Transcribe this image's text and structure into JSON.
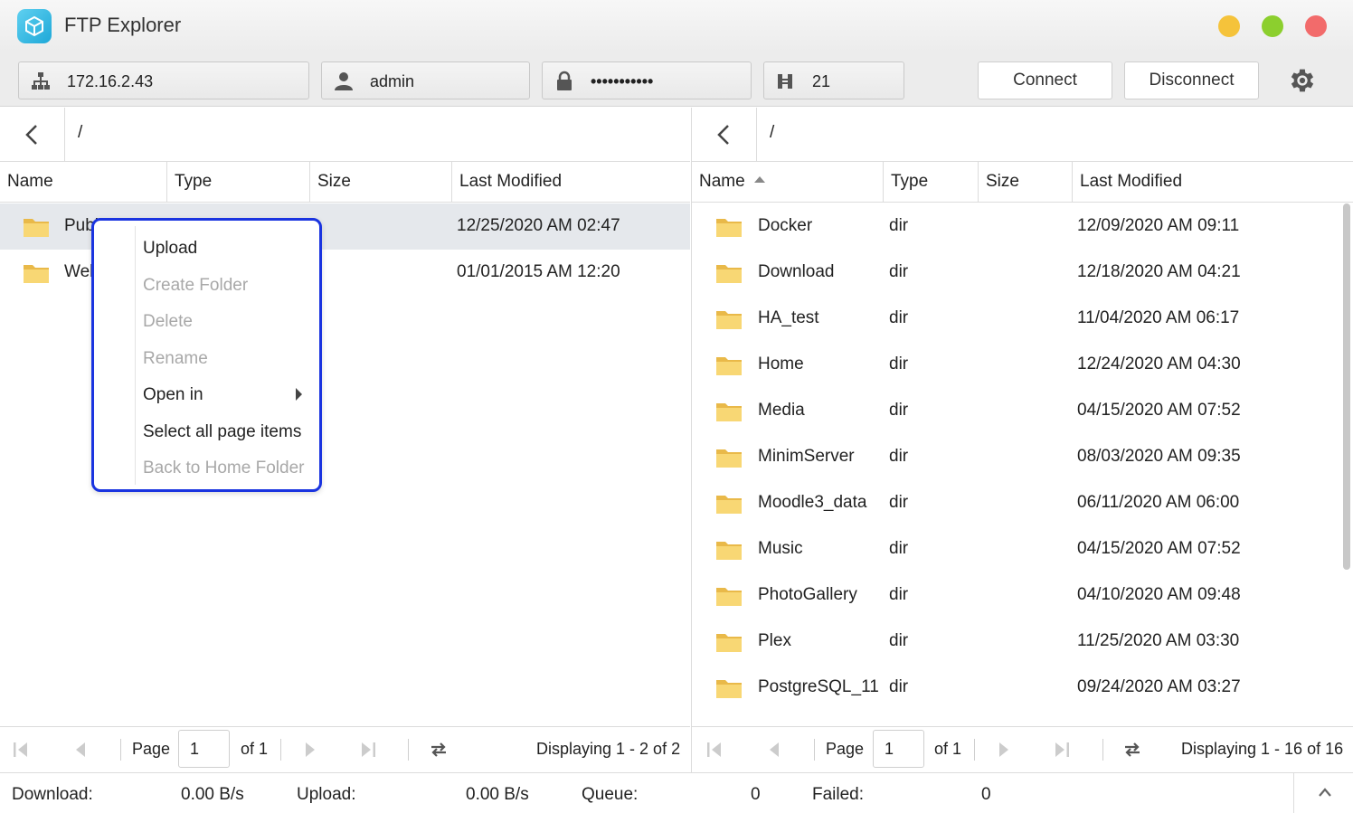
{
  "window": {
    "title": "FTP Explorer",
    "app_icon": "cube-icon",
    "controls": [
      {
        "name": "minimize",
        "color": "#f5c33b"
      },
      {
        "name": "maximize",
        "color": "#8ccf2e"
      },
      {
        "name": "close",
        "color": "#f26b6b"
      }
    ]
  },
  "toolbar": {
    "host": "172.16.2.43",
    "user": "admin",
    "password": "•••••••••••",
    "port": "21",
    "connect_label": "Connect",
    "disconnect_label": "Disconnect",
    "settings_icon": "gear-icon"
  },
  "left": {
    "path": "/",
    "columns": [
      "Name",
      "Type",
      "Size",
      "Last Modified"
    ],
    "rows": [
      {
        "name": "Public",
        "type": "",
        "size": "",
        "modified": "12/25/2020 AM 02:47",
        "selected": true
      },
      {
        "name": "Web",
        "type": "",
        "size": "",
        "modified": "01/01/2015 AM 12:20",
        "selected": false
      }
    ],
    "pager": {
      "page_label": "Page",
      "page": "1",
      "of": "of 1",
      "display": "Displaying 1 - 2 of 2"
    }
  },
  "right": {
    "path": "/",
    "columns": [
      "Name",
      "Type",
      "Size",
      "Last Modified"
    ],
    "sort": "Name ascending",
    "rows": [
      {
        "name": "Docker",
        "type": "dir",
        "size": "",
        "modified": "12/09/2020 AM 09:11"
      },
      {
        "name": "Download",
        "type": "dir",
        "size": "",
        "modified": "12/18/2020 AM 04:21"
      },
      {
        "name": "HA_test",
        "type": "dir",
        "size": "",
        "modified": "11/04/2020 AM 06:17"
      },
      {
        "name": "Home",
        "type": "dir",
        "size": "",
        "modified": "12/24/2020 AM 04:30"
      },
      {
        "name": "Media",
        "type": "dir",
        "size": "",
        "modified": "04/15/2020 AM 07:52"
      },
      {
        "name": "MinimServer",
        "type": "dir",
        "size": "",
        "modified": "08/03/2020 AM 09:35"
      },
      {
        "name": "Moodle3_data",
        "type": "dir",
        "size": "",
        "modified": "06/11/2020 AM 06:00"
      },
      {
        "name": "Music",
        "type": "dir",
        "size": "",
        "modified": "04/15/2020 AM 07:52"
      },
      {
        "name": "PhotoGallery",
        "type": "dir",
        "size": "",
        "modified": "04/10/2020 AM 09:48"
      },
      {
        "name": "Plex",
        "type": "dir",
        "size": "",
        "modified": "11/25/2020 AM 03:30"
      },
      {
        "name": "PostgreSQL_11",
        "type": "dir",
        "size": "",
        "modified": "09/24/2020 AM 03:27"
      }
    ],
    "pager": {
      "page_label": "Page",
      "page": "1",
      "of": "of 1",
      "display": "Displaying 1 - 16 of 16"
    }
  },
  "context_menu": {
    "items": [
      {
        "label": "Upload",
        "enabled": true
      },
      {
        "label": "Create Folder",
        "enabled": false
      },
      {
        "label": "Delete",
        "enabled": false
      },
      {
        "label": "Rename",
        "enabled": false
      },
      {
        "label": "Open in",
        "enabled": true,
        "submenu": true
      },
      {
        "label": "Select all page items",
        "enabled": true
      },
      {
        "label": "Back to Home Folder",
        "enabled": false
      }
    ],
    "highlight_color": "#1a34e0"
  },
  "status": {
    "download_label": "Download:",
    "download_value": "0.00 B/s",
    "upload_label": "Upload:",
    "upload_value": "0.00 B/s",
    "queue_label": "Queue:",
    "queue_value": "0",
    "failed_label": "Failed:",
    "failed_value": "0"
  }
}
